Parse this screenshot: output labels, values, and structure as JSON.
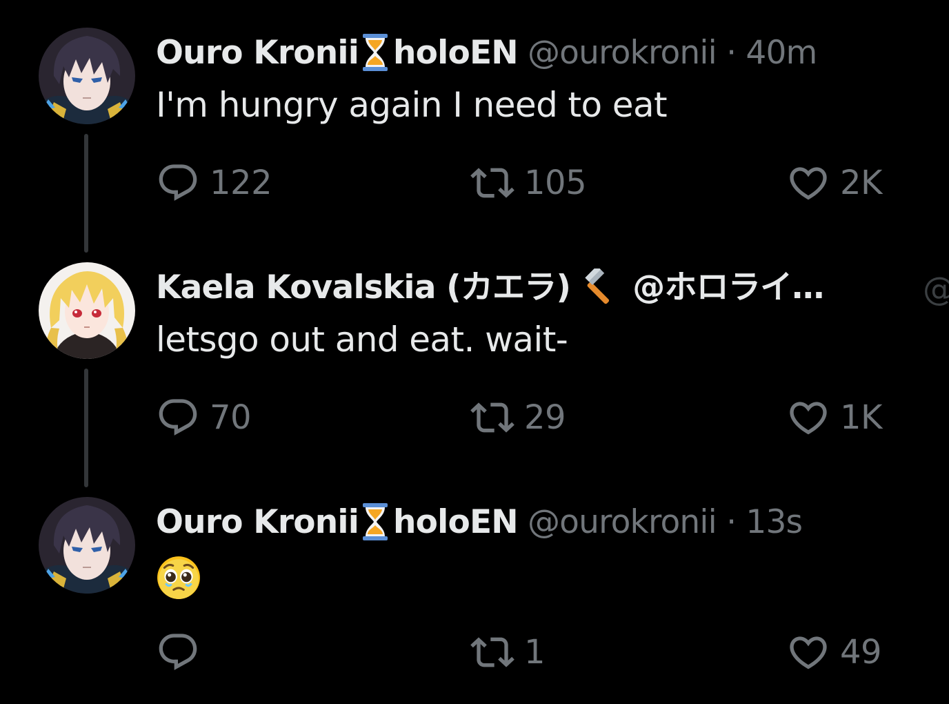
{
  "thread": [
    {
      "author": {
        "name": "Ouro Kronii",
        "name_suffix": "holoEN",
        "badge_icon": "hourglass-icon",
        "handle": "@ourokronii",
        "avatar_icon": "dark-hair-anime-avatar"
      },
      "separator": "·",
      "time": "40m",
      "text": "I'm hungry again I need to eat",
      "replies": "122",
      "retweets": "105",
      "likes": "2K"
    },
    {
      "author": {
        "name": "Kaela Kovalskia (カエラ)",
        "badge_icon": "hammer-icon",
        "handle": "@ホロライ…",
        "avatar_icon": "blonde-hair-anime-avatar"
      },
      "overflow_text": "@",
      "text": "letsgo out and eat. wait-",
      "replies": "70",
      "retweets": "29",
      "likes": "1K"
    },
    {
      "author": {
        "name": "Ouro Kronii",
        "name_suffix": "holoEN",
        "badge_icon": "hourglass-icon",
        "handle": "@ourokronii",
        "avatar_icon": "dark-hair-anime-avatar"
      },
      "separator": "·",
      "time": "13s",
      "text_emoji": "pleading-face-emoji",
      "replies": "",
      "retweets": "1",
      "likes": "49"
    }
  ],
  "colors": {
    "background": "#000000",
    "primary_text": "#e7e9ea",
    "secondary_text": "#71767b",
    "thread_line": "#333639"
  }
}
